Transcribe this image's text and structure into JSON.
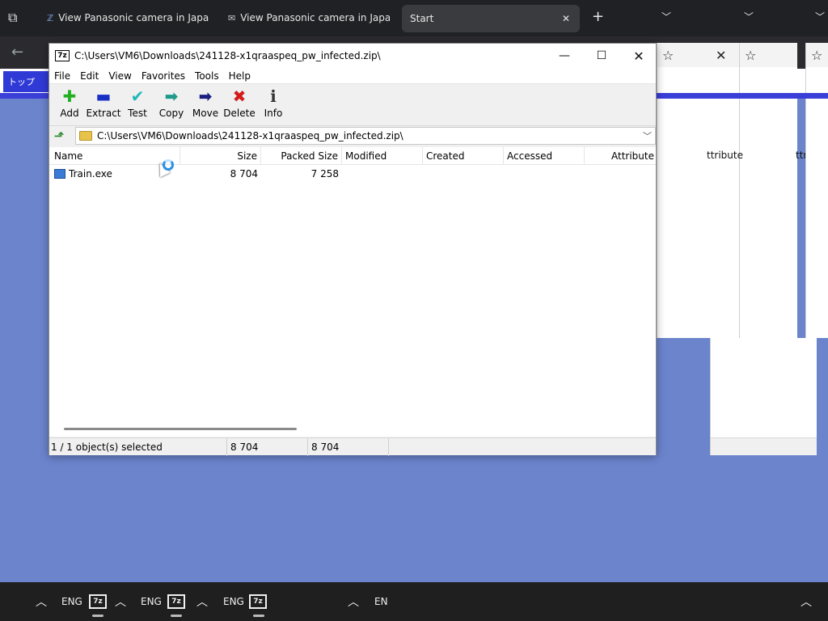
{
  "browser": {
    "tabs": [
      {
        "label": "View Panasonic camera in Japa",
        "close": "✕"
      },
      {
        "label": "View Panasonic camera in Japa",
        "close": "✕"
      }
    ],
    "start_tab": {
      "label": "Start",
      "close": "✕"
    },
    "new_tab": "+",
    "jp_nav_label": "トップ"
  },
  "window": {
    "title": "C:\\Users\\VM6\\Downloads\\241128-x1qraaspeq_pw_infected.zip\\",
    "app_icon": "7z",
    "controls": {
      "minimize": "—",
      "maximize": "☐",
      "close": "✕"
    }
  },
  "menu": [
    "File",
    "Edit",
    "View",
    "Favorites",
    "Tools",
    "Help"
  ],
  "toolbar": [
    {
      "label": "Add",
      "icon": "plus-icon",
      "glyph": "✚",
      "color": "#22b022"
    },
    {
      "label": "Extract",
      "icon": "minus-icon",
      "glyph": "▬",
      "color": "#1a2fc4"
    },
    {
      "label": "Test",
      "icon": "check-icon",
      "glyph": "✔",
      "color": "#20b8b8"
    },
    {
      "label": "Copy",
      "icon": "arrow-right-icon",
      "glyph": "➡",
      "color": "#1e9a8a"
    },
    {
      "label": "Move",
      "icon": "arrow-right-icon",
      "glyph": "➡",
      "color": "#1a2080"
    },
    {
      "label": "Delete",
      "icon": "x-icon",
      "glyph": "✖",
      "color": "#d41a1a"
    },
    {
      "label": "Info",
      "icon": "info-icon",
      "glyph": "ℹ",
      "color": "#333333"
    }
  ],
  "address": {
    "path": "C:\\Users\\VM6\\Downloads\\241128-x1qraaspeq_pw_infected.zip\\"
  },
  "columns": [
    "Name",
    "Size",
    "Packed Size",
    "Modified",
    "Created",
    "Accessed",
    "Attribute"
  ],
  "files": [
    {
      "name": "Train.exe",
      "size": "8 704",
      "packed": "7 258"
    }
  ],
  "status": {
    "selection": "1 / 1 object(s) selected",
    "size": "8 704",
    "packed": "8 704"
  },
  "ghost_column_label": "ttribute",
  "taskbar": {
    "lang1": "ENG",
    "lang2": "ENG",
    "lang3": "ENG",
    "lang4": "EN",
    "app_icon": "7z"
  }
}
